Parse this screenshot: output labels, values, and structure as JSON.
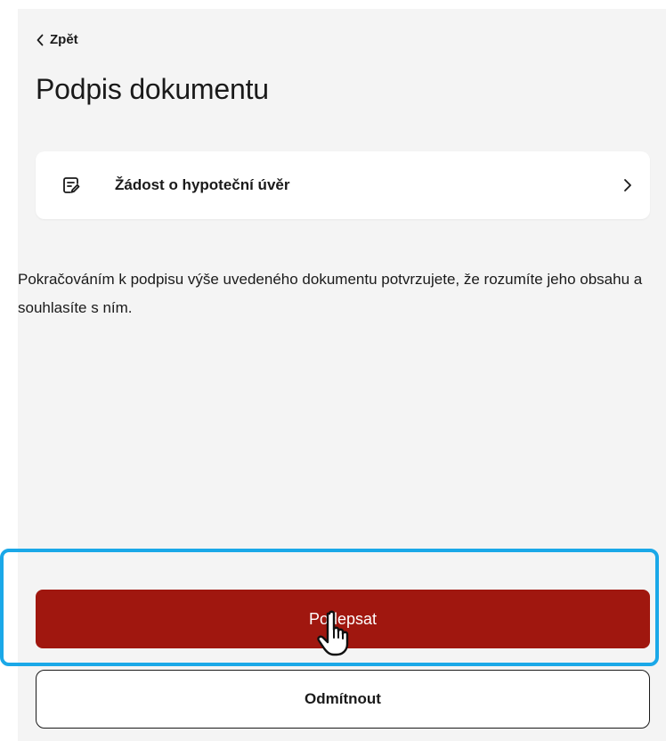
{
  "header": {
    "back_label": "Zpět",
    "title": "Podpis dokumentu"
  },
  "document": {
    "icon": "edit-document-icon",
    "title": "Žádost o hypoteční úvěr"
  },
  "consent": {
    "text": "Pokračováním k podpisu výše uvedeného dokumentu potvrzujete, že rozumíte jeho obsahu a souhlasíte s ním."
  },
  "actions": {
    "sign_label": "Podepsat",
    "reject_label": "Odmítnout"
  },
  "colors": {
    "primary": "#a0170f",
    "highlight": "#1aa8e8",
    "background": "#f4f4f4"
  }
}
